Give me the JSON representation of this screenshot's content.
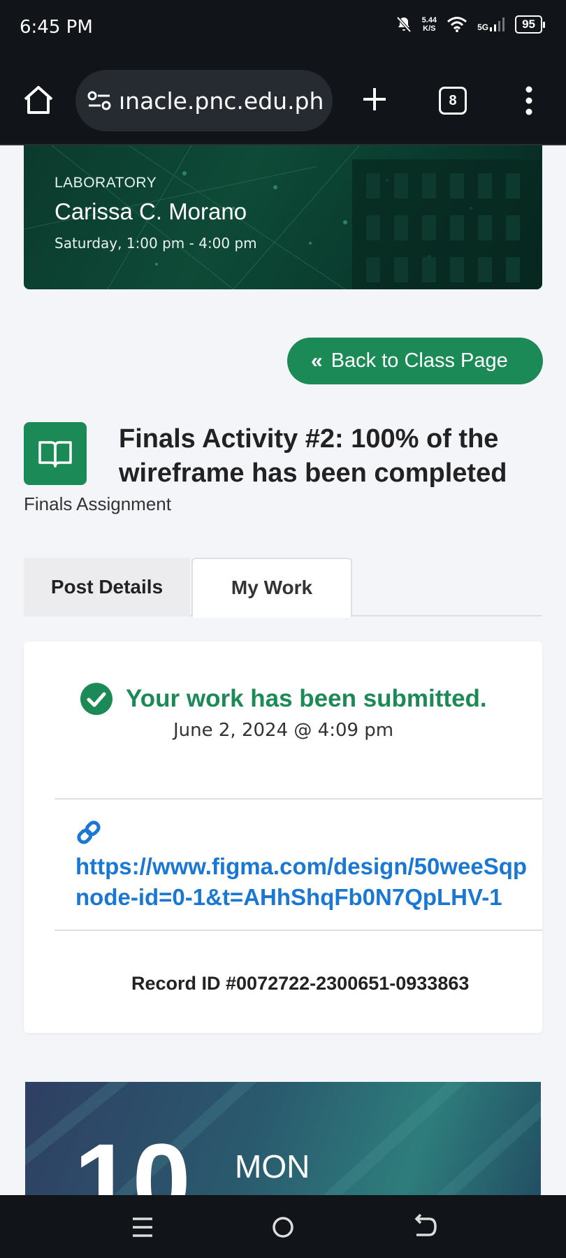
{
  "status_bar": {
    "time": "6:45 PM",
    "net_speed_value": "5.44",
    "net_speed_unit": "K/S",
    "network": "5G",
    "battery": "95"
  },
  "browser": {
    "url": "ınacle.pnc.edu.ph",
    "tab_count": "8"
  },
  "class_banner": {
    "type": "LABORATORY",
    "teacher": "Carissa C. Morano",
    "schedule": "Saturday, 1:00 pm - 4:00 pm"
  },
  "back_button_label": "Back to Class Page",
  "activity": {
    "title_line1": "Finals Activity #2: 100% of the",
    "title_line2": "wireframe has been completed",
    "subtitle": "Finals Assignment"
  },
  "tabs": {
    "post_details": "Post Details",
    "my_work": "My Work"
  },
  "submission": {
    "status": "Your work has been submitted.",
    "date": "June 2, 2024 @ 4:09 pm",
    "link_line1": "https://www.figma.com/design/50weeSqp",
    "link_line2": "node-id=0-1&t=AHhShqFb0N7QpLHV-1",
    "record_id": "Record ID #0072722-2300651-0933863"
  },
  "calendar": {
    "day": "10",
    "weekday": "MON"
  },
  "colors": {
    "accent_green": "#1c8a57",
    "link_blue": "#1a78d2"
  }
}
